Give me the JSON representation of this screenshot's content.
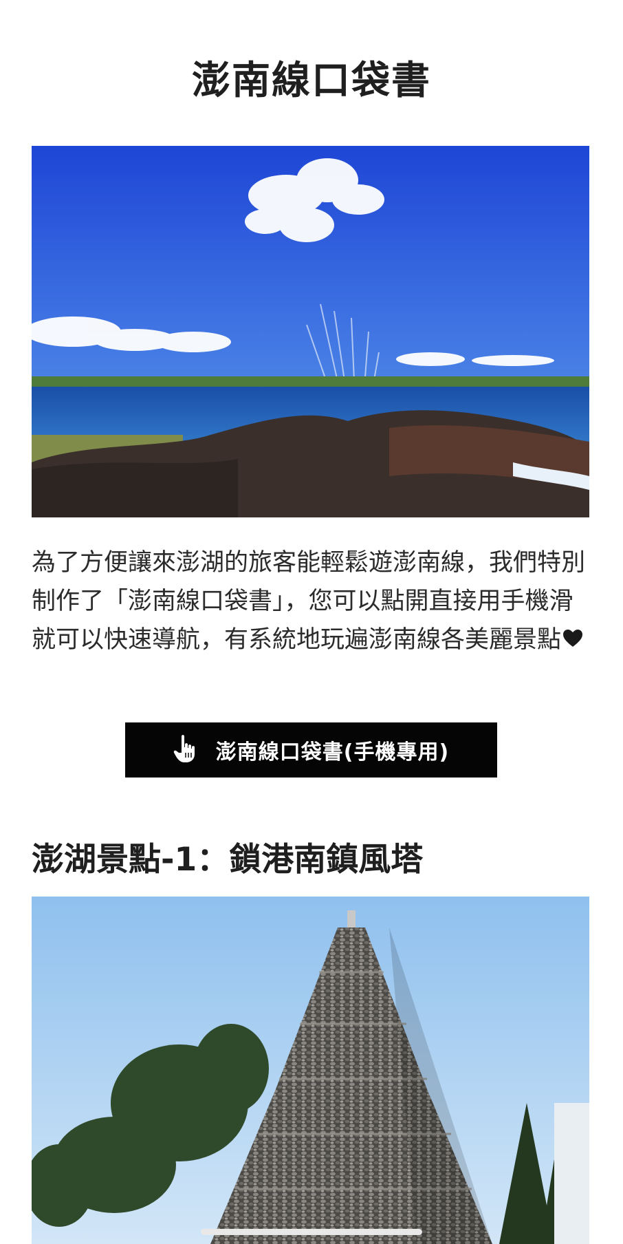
{
  "page": {
    "title": "澎南線口袋書"
  },
  "hero": {
    "alt": "",
    "colors": {
      "sky": "#2a55d8",
      "sea": "#1d5fb0",
      "rock": "#3a2f2b"
    }
  },
  "intro": {
    "text": "為了方便讓來澎湖的旅客能輕鬆遊澎南線，我們特別制作了「澎南線口袋書」，您可以點開直接用手機滑就可以快速導航，有系統地玩遍澎南線各美麗景點",
    "icon": "heart-icon"
  },
  "cta": {
    "label": "澎南線口袋書(手機專用)",
    "icon": "pointing-hand-icon",
    "colors": {
      "background": "#050505",
      "text": "#ffffff"
    }
  },
  "spot1": {
    "heading": "澎湖景點-1：鎖港南鎮風塔"
  }
}
